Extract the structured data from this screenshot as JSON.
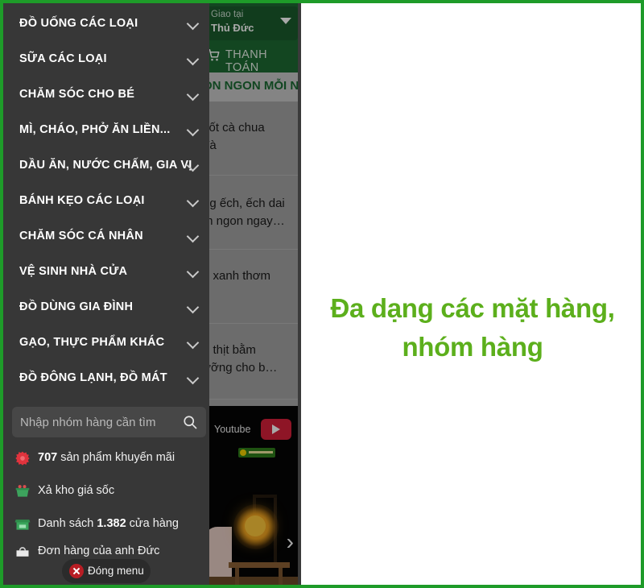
{
  "frame": {
    "accent_color": "#1e9b29"
  },
  "app": {
    "header": {
      "deliver_label": "Giao tại",
      "deliver_location": "Thủ Đức",
      "caret_icon": "chevron-down-icon",
      "cart_icon": "shopping-cart-icon",
      "checkout_label": "THANH TOÁN"
    },
    "section_title": "ÓN NGON MỖI N",
    "rows": [
      {
        "line1": "sốt cà chua",
        "line2": "đà"
      },
      {
        "line1": "ng ếch, ếch dai",
        "line2": "m ngon ngay…"
      },
      {
        "line1": "u xanh thơm",
        "line2": ""
      },
      {
        "line1": "o thịt bằm",
        "line2": "ưỡng cho b…"
      }
    ],
    "video_card": {
      "source_label": "Youtube",
      "play_icon": "youtube-play-icon",
      "brand_badge": "bach-hoa-xanh-badge",
      "next_icon": "chevron-right-icon"
    }
  },
  "drawer": {
    "menu_items": [
      {
        "label": "ĐỒ UỐNG CÁC LOẠI",
        "icon": "chevron-down-icon"
      },
      {
        "label": "SỮA CÁC LOẠI",
        "icon": "chevron-down-icon"
      },
      {
        "label": "CHĂM SÓC CHO BÉ",
        "icon": "chevron-down-icon"
      },
      {
        "label": "MÌ, CHÁO, PHỞ ĂN LIỀN...",
        "icon": "chevron-down-icon"
      },
      {
        "label": "DẦU ĂN, NƯỚC CHẤM, GIA VỊ",
        "icon": "chevron-down-icon"
      },
      {
        "label": "BÁNH KẸO CÁC LOẠI",
        "icon": "chevron-down-icon"
      },
      {
        "label": "CHĂM SÓC CÁ NHÂN",
        "icon": "chevron-down-icon"
      },
      {
        "label": "VỆ SINH NHÀ CỬA",
        "icon": "chevron-down-icon"
      },
      {
        "label": "ĐỒ DÙNG GIA ĐÌNH",
        "icon": "chevron-down-icon"
      },
      {
        "label": "GẠO, THỰC PHẨM KHÁC",
        "icon": "chevron-down-icon"
      },
      {
        "label": "ĐỒ ĐÔNG LẠNH, ĐỒ MÁT",
        "icon": "chevron-down-icon"
      }
    ],
    "search": {
      "placeholder": "Nhập nhóm hàng cần tìm",
      "value": "",
      "icon": "search-icon"
    },
    "quick_links": [
      {
        "icon": "promotion-flower-icon",
        "strong": "707",
        "text_before": "",
        "text_after": " sản phẩm khuyến mãi"
      },
      {
        "icon": "clearance-basket-icon",
        "strong": "",
        "text_before": "Xả kho giá sốc",
        "text_after": ""
      },
      {
        "icon": "store-icon",
        "strong": "1.382",
        "text_before": " Danh sách ",
        "text_after": " cửa hàng"
      },
      {
        "icon": "order-bag-icon",
        "strong": "",
        "text_before": "Đơn hàng của anh Đức",
        "text_after": ""
      }
    ],
    "close_menu": {
      "label": "Đóng menu",
      "icon": "close-circle-icon"
    }
  },
  "caption": {
    "line1": "Đa dạng các mặt hàng,",
    "line2": "nhóm hàng",
    "color": "#5caf1c"
  }
}
